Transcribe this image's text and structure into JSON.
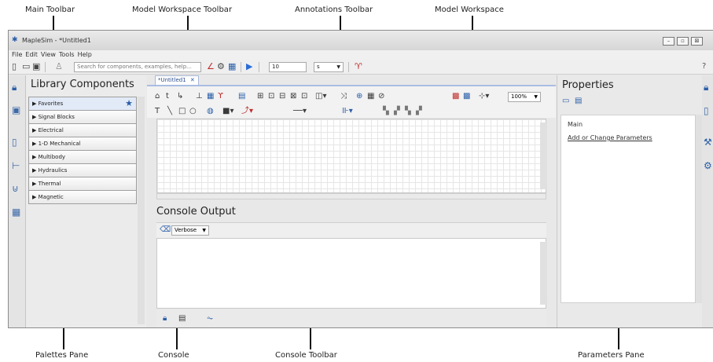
{
  "callouts": {
    "main_toolbar": "Main Toolbar",
    "model_workspace_toolbar": "Model Workspace Toolbar",
    "annotations_toolbar": "Annotations Toolbar",
    "model_workspace": "Model Workspace",
    "palettes_pane": "Palettes Pane",
    "console": "Console",
    "console_toolbar": "Console Toolbar",
    "parameters_pane": "Parameters Pane"
  },
  "window": {
    "title": "MapleSim - *Untitled1",
    "minimize": "–",
    "maximize": "▫",
    "close": "⊠"
  },
  "menu": [
    "File",
    "Edit",
    "View",
    "Tools",
    "Help"
  ],
  "main_toolbar": {
    "search_placeholder": "Search for components, examples, help...",
    "time_value": "10",
    "time_unit": "s",
    "help": "?"
  },
  "library": {
    "title": "Library Components",
    "items": [
      "Favorites",
      "Signal Blocks",
      "Electrical",
      "1-D Mechanical",
      "Multibody",
      "Hydraulics",
      "Thermal",
      "Magnetic"
    ]
  },
  "workspace": {
    "tab_label": "*Untitled1",
    "tab_close": "✕",
    "zoom": "100%"
  },
  "console": {
    "title": "Console Output",
    "verbose": "Verbose"
  },
  "properties": {
    "title": "Properties",
    "section": "Main",
    "link": "Add or Change Parameters"
  },
  "icons": {
    "star": "favorites-star-icon",
    "lock": "lock-icon",
    "eraser": "eraser-icon",
    "play": "play-icon",
    "probe": "probe-icon"
  },
  "colors": {
    "accent": "#2a5ea8",
    "tab_border": "#a9bde3",
    "play": "#2a6ed6"
  }
}
